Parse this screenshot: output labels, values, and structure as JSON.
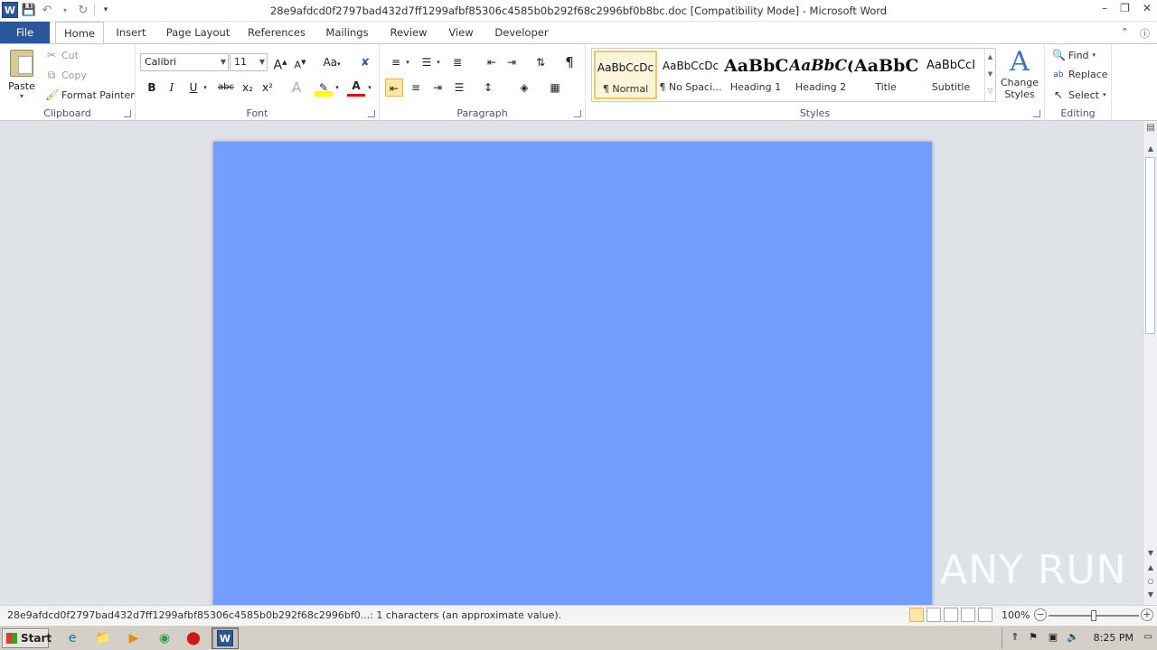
{
  "window": {
    "title": "28e9afdcd0f2797bad432d7ff1299afbf85306c4585b0b292f68c2996bf0b8bc.doc [Compatibility Mode]  -  Microsoft Word",
    "app_logo": "W",
    "controls": {
      "minimize": "–",
      "maximize": "❐",
      "close": "✕"
    }
  },
  "quick_access": {
    "save_icon": "save-icon",
    "undo_icon": "undo-icon",
    "redo_icon": "redo-icon",
    "customize_icon": "customize-qat-icon"
  },
  "tabs": [
    {
      "label": "File"
    },
    {
      "label": "Home"
    },
    {
      "label": "Insert"
    },
    {
      "label": "Page Layout"
    },
    {
      "label": "References"
    },
    {
      "label": "Mailings"
    },
    {
      "label": "Review"
    },
    {
      "label": "View"
    },
    {
      "label": "Developer"
    }
  ],
  "ribbon": {
    "clipboard": {
      "label": "Clipboard",
      "paste": "Paste",
      "cut": "Cut",
      "copy": "Copy",
      "format_painter": "Format Painter"
    },
    "font": {
      "label": "Font",
      "font_name": "Calibri",
      "font_size": "11",
      "bold": "B",
      "italic": "I",
      "underline": "U",
      "strikethrough": "abc",
      "subscript": "x₂",
      "superscript": "x²",
      "change_case": "Aa",
      "grow": "A",
      "shrink": "A"
    },
    "paragraph": {
      "label": "Paragraph",
      "show_marks": "¶"
    },
    "styles": {
      "label": "Styles",
      "items": [
        {
          "sample": "AaBbCcDc",
          "name": "¶ Normal"
        },
        {
          "sample": "AaBbCcDc",
          "name": "¶ No Spaci..."
        },
        {
          "sample": "AaBbC(",
          "name": "Heading 1"
        },
        {
          "sample": "AaBbC(",
          "name": "Heading 2"
        },
        {
          "sample": "AaBbC(",
          "name": "Title"
        },
        {
          "sample": "AaBbCcI",
          "name": "Subtitle"
        }
      ],
      "change_styles": "Change Styles"
    },
    "editing": {
      "label": "Editing",
      "find": "Find",
      "replace": "Replace",
      "select": "Select"
    }
  },
  "document": {
    "page_color": "#729fff"
  },
  "watermark": "ANY RUN",
  "status": {
    "text": "28e9afdcd0f2797bad432d7ff1299afbf85306c4585b0b292f68c2996bf0...: 1 characters (an approximate value).",
    "zoom": "100%"
  },
  "taskbar": {
    "start": "Start",
    "clock": "8:25 PM"
  }
}
